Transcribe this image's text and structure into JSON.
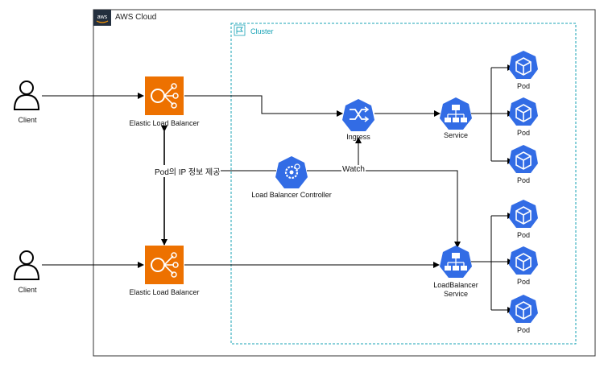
{
  "groups": {
    "aws_cloud": "AWS Cloud",
    "aws_logo_text": "aws",
    "cluster": "Cluster"
  },
  "nodes": {
    "client_top": "Client",
    "client_bottom": "Client",
    "elb_top": "Elastic Load Balancer",
    "elb_bottom": "Elastic Load Balancer",
    "ingress": "Ingress",
    "service": "Service",
    "lb_controller": "Load Balancer Controller",
    "lb_service_line1": "LoadBalancer",
    "lb_service_line2": "Service",
    "pods": [
      "Pod",
      "Pod",
      "Pod",
      "Pod",
      "Pod",
      "Pod"
    ]
  },
  "edges": {
    "pod_ip_info": "Pod의 IP 정보 제공",
    "watch": "Watch"
  },
  "colors": {
    "elb_orange": "#ed7100",
    "k8s_blue": "#326ce5",
    "cluster_teal": "#19a3b6",
    "line": "#000000"
  }
}
